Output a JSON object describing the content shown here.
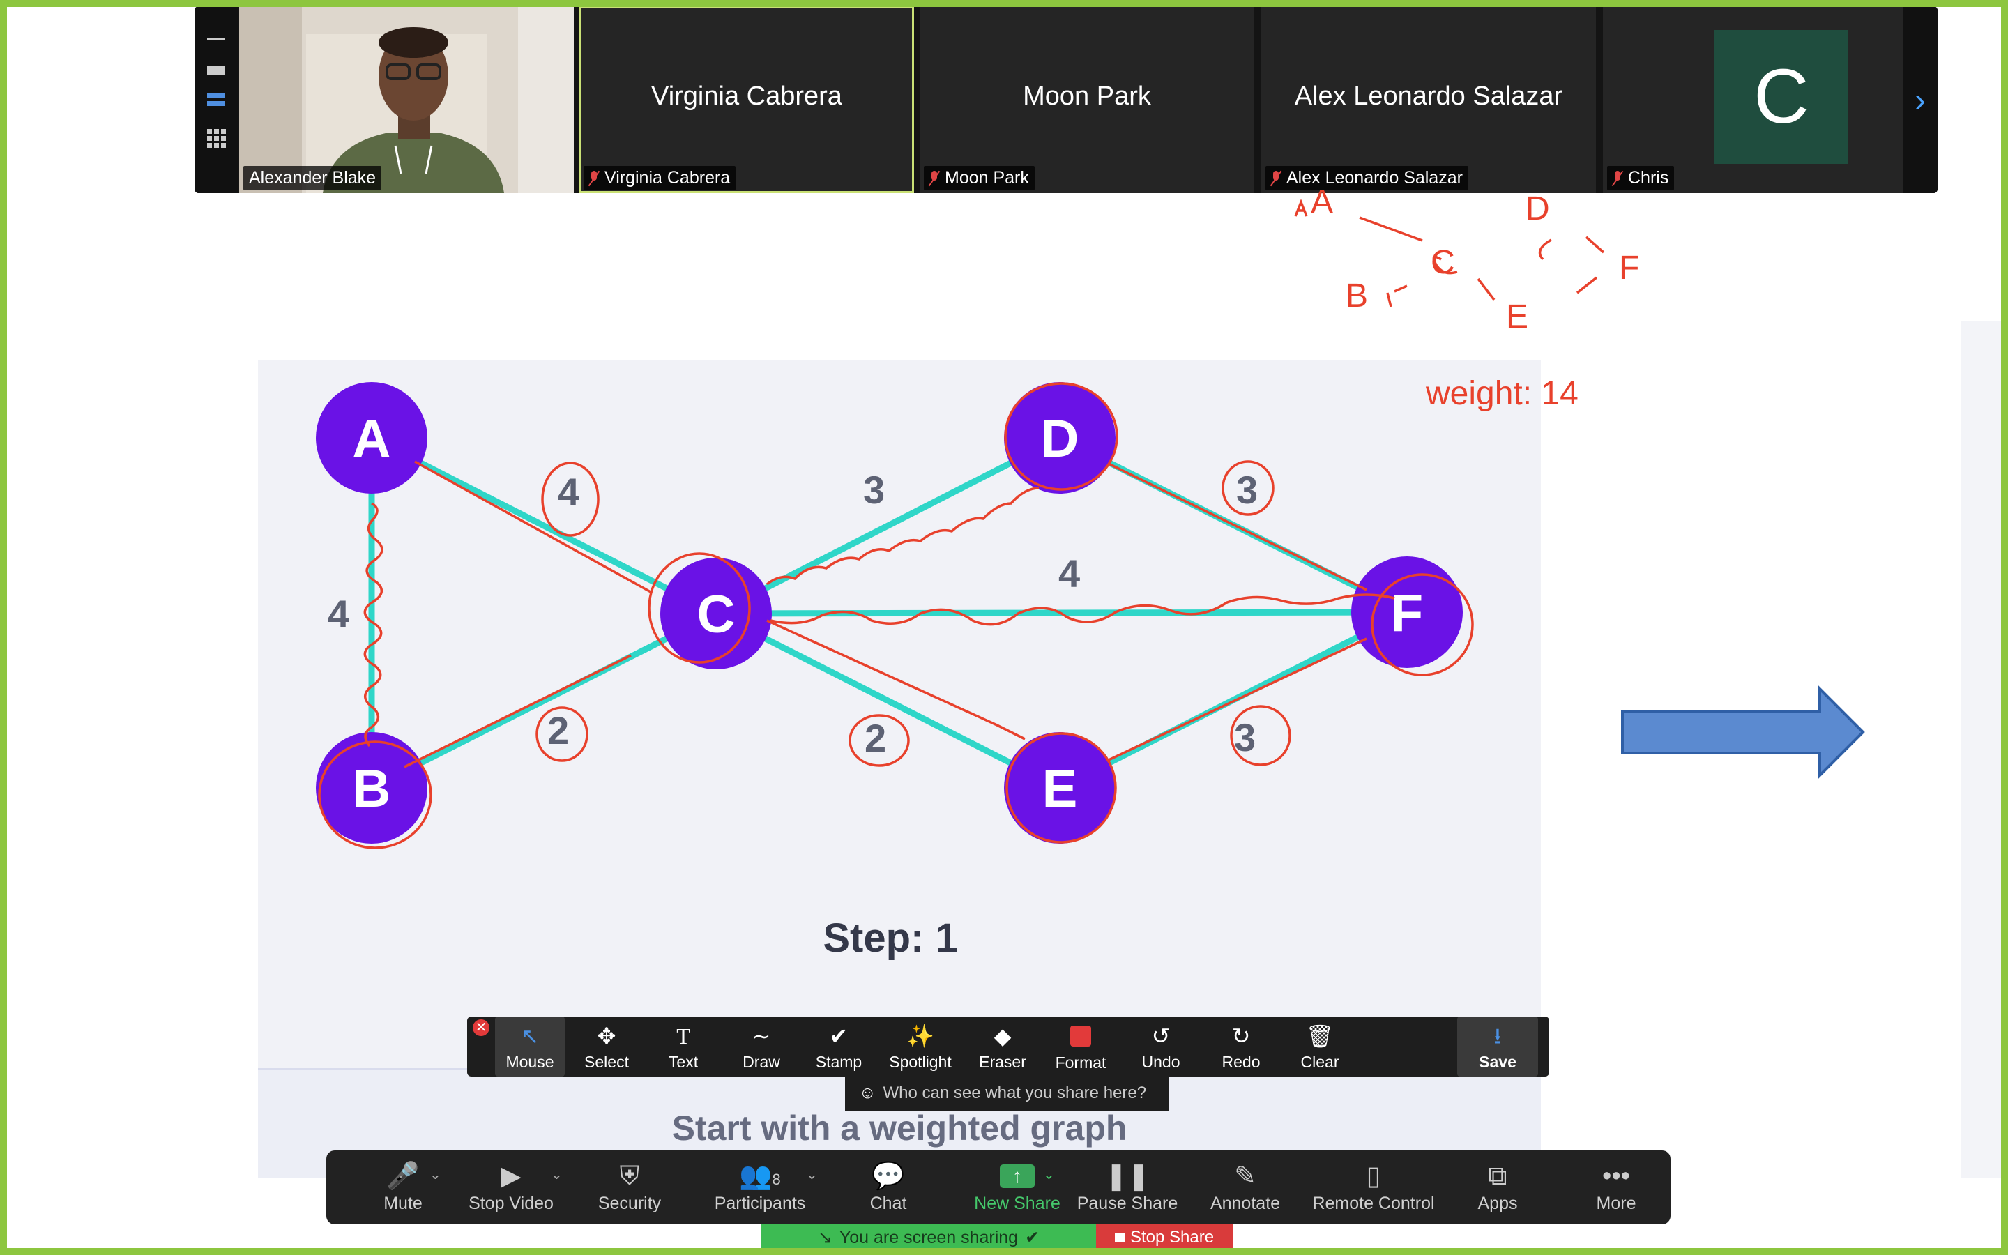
{
  "participants": [
    {
      "display_name": "",
      "tag": "Alexander Blake",
      "video": true
    },
    {
      "display_name": "Virginia Cabrera",
      "tag": "Virginia Cabrera",
      "muted": true
    },
    {
      "display_name": "Moon Park",
      "tag": "Moon Park",
      "muted": true
    },
    {
      "display_name": "Alex Leonardo Salazar",
      "tag": "Alex Leonardo Salazar",
      "muted": true
    },
    {
      "display_name": "",
      "tag": "Chris",
      "avatar_letter": "C",
      "avatar_color": "#1f4d3e",
      "muted": true
    }
  ],
  "strip_next_icon": "chevron-right-icon",
  "slide": {
    "nodes": [
      {
        "id": "A",
        "label": "A"
      },
      {
        "id": "B",
        "label": "B"
      },
      {
        "id": "C",
        "label": "C"
      },
      {
        "id": "D",
        "label": "D"
      },
      {
        "id": "E",
        "label": "E"
      },
      {
        "id": "F",
        "label": "F"
      }
    ],
    "edges": [
      {
        "from": "A",
        "to": "B",
        "weight": "4"
      },
      {
        "from": "A",
        "to": "C",
        "weight": "4"
      },
      {
        "from": "B",
        "to": "C",
        "weight": "2"
      },
      {
        "from": "C",
        "to": "D",
        "weight": "3"
      },
      {
        "from": "C",
        "to": "F",
        "weight": "4"
      },
      {
        "from": "C",
        "to": "E",
        "weight": "2"
      },
      {
        "from": "D",
        "to": "F",
        "weight": "3"
      },
      {
        "from": "E",
        "to": "F",
        "weight": "3"
      }
    ],
    "step_label": "Step: 1",
    "caption": "Start with a weighted graph",
    "node_color": "#6a12e6",
    "edge_color": "#2fd6c8"
  },
  "ink_annotations": {
    "tree_letters": [
      "A",
      "D",
      "C",
      "F",
      "B",
      "E"
    ],
    "weight_note": "weight: 14",
    "ink_color": "#e8412c"
  },
  "annotate_toolbar": {
    "items": [
      {
        "key": "mouse",
        "label": "Mouse",
        "icon": "cursor-icon",
        "selected": true
      },
      {
        "key": "select",
        "label": "Select",
        "icon": "move-icon"
      },
      {
        "key": "text",
        "label": "Text",
        "icon": "text-icon"
      },
      {
        "key": "draw",
        "label": "Draw",
        "icon": "draw-icon"
      },
      {
        "key": "stamp",
        "label": "Stamp",
        "icon": "checkmark-icon"
      },
      {
        "key": "spotlight",
        "label": "Spotlight",
        "icon": "spotlight-icon"
      },
      {
        "key": "eraser",
        "label": "Eraser",
        "icon": "eraser-icon"
      },
      {
        "key": "format",
        "label": "Format",
        "icon": "color-swatch-icon"
      },
      {
        "key": "undo",
        "label": "Undo",
        "icon": "undo-icon"
      },
      {
        "key": "redo",
        "label": "Redo",
        "icon": "redo-icon"
      },
      {
        "key": "clear",
        "label": "Clear",
        "icon": "trash-icon"
      },
      {
        "key": "save",
        "label": "Save",
        "icon": "save-icon"
      }
    ],
    "who_can_see": "Who can see what you share here?"
  },
  "controls": {
    "items": [
      {
        "key": "mute",
        "label": "Mute",
        "icon": "microphone-icon"
      },
      {
        "key": "video",
        "label": "Stop Video",
        "icon": "video-camera-icon"
      },
      {
        "key": "security",
        "label": "Security",
        "icon": "shield-icon"
      },
      {
        "key": "participants",
        "label": "Participants",
        "icon": "participants-icon",
        "count": "8"
      },
      {
        "key": "chat",
        "label": "Chat",
        "icon": "chat-bubble-icon"
      },
      {
        "key": "new_share",
        "label": "New Share",
        "icon": "share-screen-icon"
      },
      {
        "key": "pause_share",
        "label": "Pause Share",
        "icon": "pause-icon"
      },
      {
        "key": "annotate",
        "label": "Annotate",
        "icon": "pencil-icon"
      },
      {
        "key": "remote",
        "label": "Remote Control",
        "icon": "mouse-icon"
      },
      {
        "key": "apps",
        "label": "Apps",
        "icon": "apps-icon"
      },
      {
        "key": "more",
        "label": "More",
        "icon": "more-dots-icon"
      }
    ]
  },
  "share_status": {
    "sharing_text": "You are screen sharing",
    "stop_label": "Stop Share"
  },
  "colors": {
    "frame_green": "#8dc63f",
    "share_green": "#3dbb53",
    "stop_red": "#d93b3b",
    "arrow_blue": "#5b8ad0"
  }
}
